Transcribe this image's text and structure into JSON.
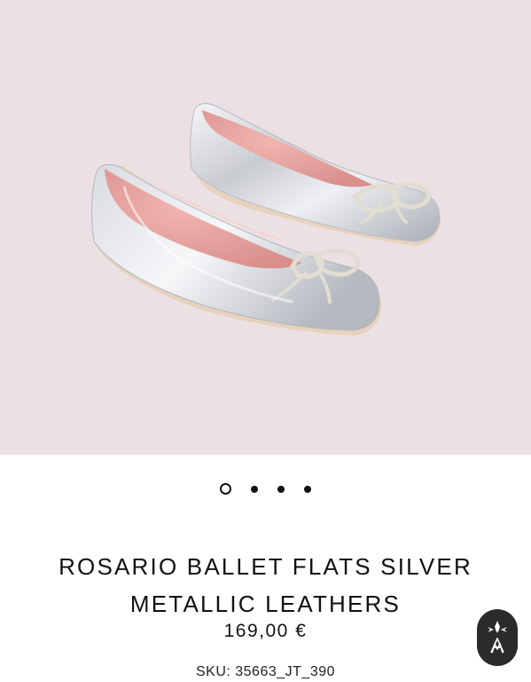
{
  "product": {
    "image_alt": "Rosario ballet flats silver metallic leathers",
    "title": "ROSARIO BALLET FLATS SILVER METALLIC LEATHERS",
    "price": "169,00 €",
    "sku": "SKU: 35663_JT_390"
  },
  "gallery": {
    "dot_count": 4,
    "active_index": 0
  },
  "chat_button": {
    "icon": "brand-emblem-icon"
  },
  "colors": {
    "hero_background": "#ebe1e4",
    "text": "#111111",
    "chat_button": "#2b2b2b"
  }
}
